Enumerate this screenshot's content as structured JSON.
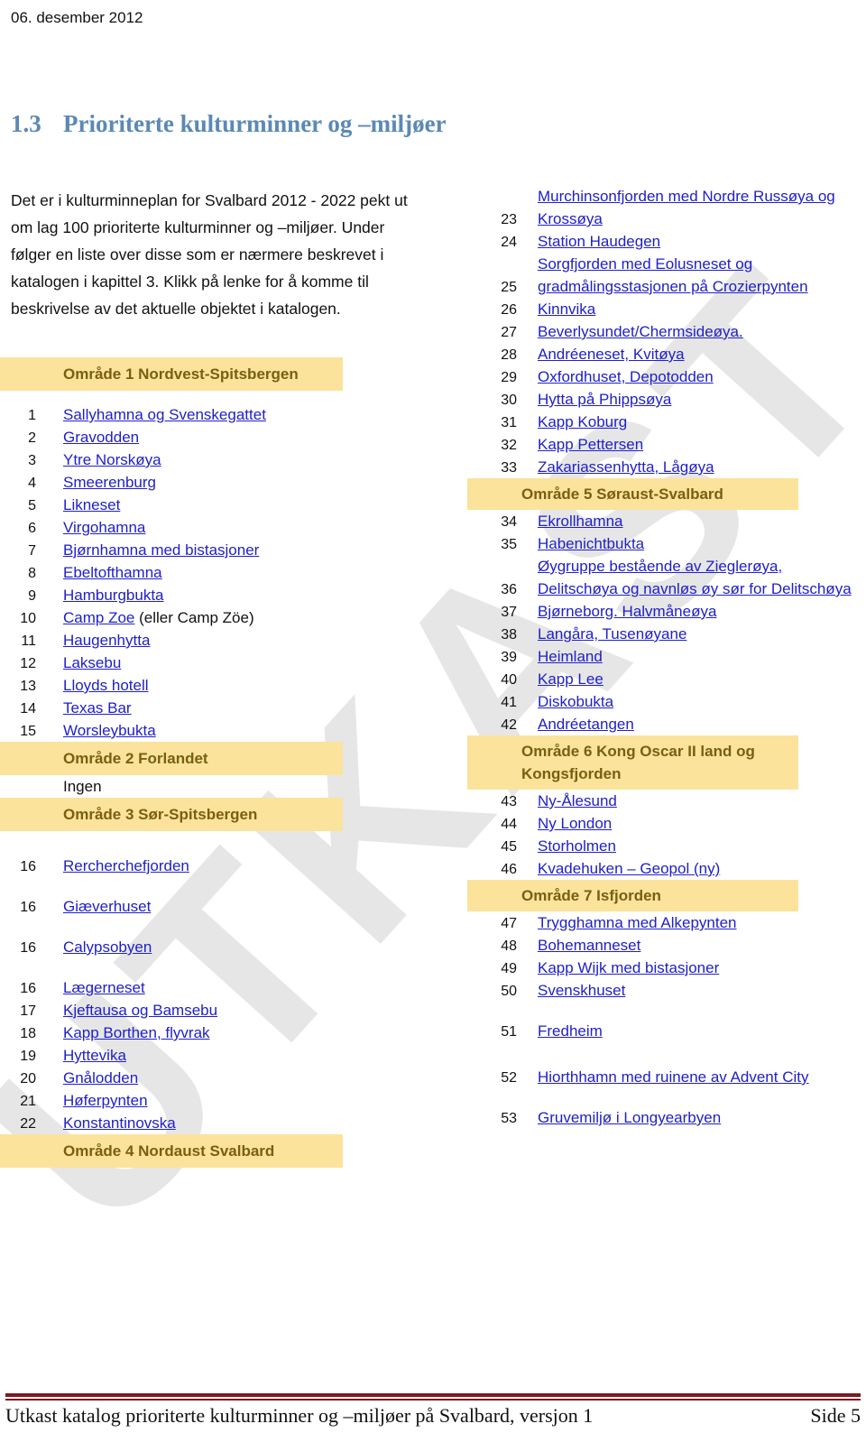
{
  "header": {
    "date": "06. desember 2012"
  },
  "watermark": {
    "text": "UTKAST"
  },
  "title": {
    "number": "1.3",
    "text": "Prioriterte kulturminner og –miljøer"
  },
  "intro": {
    "paragraph": "Det er i kulturminneplan for Svalbard 2012 - 2022 pekt ut om lag 100 prioriterte kulturminner og –miljøer. Under følger en liste over disse som er nærmere beskrevet i katalogen i kapittel 3. Klikk på lenke for å komme til beskrivelse av det aktuelle objektet i katalogen."
  },
  "left_column": [
    {
      "type": "band",
      "label": "Område 1 Nordvest-Spitsbergen"
    },
    {
      "type": "spacer",
      "size": "sp-14"
    },
    {
      "type": "entry",
      "num": "1",
      "label": "Sallyhamna og Svenskegattet",
      "link": true
    },
    {
      "type": "entry",
      "num": "2",
      "label": "Gravodden",
      "link": true
    },
    {
      "type": "entry",
      "num": "3",
      "label": "Ytre Norskøya",
      "link": true
    },
    {
      "type": "entry",
      "num": "4",
      "label": "Smeerenburg",
      "link": true
    },
    {
      "type": "entry",
      "num": "5",
      "label": "Likneset",
      "link": true
    },
    {
      "type": "entry",
      "num": "6",
      "label": "Virgohamna",
      "link": true
    },
    {
      "type": "entry",
      "num": "7",
      "label": "Bjørnhamna med bistasjoner",
      "link": true
    },
    {
      "type": "entry",
      "num": "8",
      "label": "Ebeltofthamna",
      "link": true
    },
    {
      "type": "entry",
      "num": "9",
      "label": "Hamburgbukta",
      "link": true
    },
    {
      "type": "entry",
      "num": "10",
      "label": "Camp Zoe",
      "link": true,
      "suffix": " (eller Camp Zöe)"
    },
    {
      "type": "entry",
      "num": "11",
      "label": "Haugenhytta",
      "link": true
    },
    {
      "type": "entry",
      "num": "12",
      "label": "Laksebu",
      "link": true
    },
    {
      "type": "entry",
      "num": "13",
      "label": "Lloyds hotell",
      "link": true
    },
    {
      "type": "entry",
      "num": "14",
      "label": "Texas Bar",
      "link": true
    },
    {
      "type": "entry",
      "num": "15",
      "label": "Worsleybukta",
      "link": true
    },
    {
      "type": "band",
      "label": "Område 2 Forlandet"
    },
    {
      "type": "entry",
      "num": "",
      "label": "Ingen",
      "link": false
    },
    {
      "type": "band",
      "label": "Område 3 Sør-Spitsbergen"
    },
    {
      "type": "spacer",
      "size": "sp-26"
    },
    {
      "type": "entry",
      "num": "16",
      "label": "Rercherchefjorden",
      "link": true
    },
    {
      "type": "spacer",
      "size": "sp-20"
    },
    {
      "type": "entry",
      "num": "16",
      "label": "Giæverhuset",
      "link": true
    },
    {
      "type": "spacer",
      "size": "sp-20"
    },
    {
      "type": "entry",
      "num": "16",
      "label": "Calypsobyen",
      "link": true
    },
    {
      "type": "spacer",
      "size": "sp-20"
    },
    {
      "type": "entry",
      "num": "16",
      "label": "Lægerneset",
      "link": true
    },
    {
      "type": "entry",
      "num": "17",
      "label": "Kjeftausa og Bamsebu",
      "link": true
    },
    {
      "type": "entry",
      "num": "18",
      "label": "Kapp Borthen, flyvrak",
      "link": true
    },
    {
      "type": "entry",
      "num": "19",
      "label": "Hyttevika",
      "link": true
    },
    {
      "type": "entry",
      "num": "20",
      "label": "Gnålodden",
      "link": true
    },
    {
      "type": "entry",
      "num": "21",
      "label": "Høferpynten",
      "link": true
    },
    {
      "type": "entry",
      "num": "22",
      "label": "Konstantinovska",
      "link": true
    },
    {
      "type": "band",
      "label": "Område 4 Nordaust Svalbard"
    }
  ],
  "right_column": [
    {
      "type": "entry",
      "num": "23",
      "label": "Murchinsonfjorden med Nordre Russøya og Krossøya",
      "link": true
    },
    {
      "type": "entry",
      "num": "24",
      "label": "Station Haudegen",
      "link": true
    },
    {
      "type": "entry",
      "num": "25",
      "label": "Sorgfjorden med Eolusneset og gradmålingsstasjonen på Crozierpynten",
      "link": true
    },
    {
      "type": "entry",
      "num": "26",
      "label": "Kinnvika",
      "link": true
    },
    {
      "type": "entry",
      "num": "27",
      "label": "Beverlysundet/Chermsideøya.",
      "link": true
    },
    {
      "type": "entry",
      "num": "28",
      "label": "Andréeneset, Kvitøya",
      "link": true
    },
    {
      "type": "entry",
      "num": "29",
      "label": "Oxfordhuset, Depotodden",
      "link": true
    },
    {
      "type": "entry",
      "num": "30",
      "label": "Hytta på Phippsøya",
      "link": true
    },
    {
      "type": "entry",
      "num": "31",
      "label": "Kapp Koburg",
      "link": true
    },
    {
      "type": "entry",
      "num": "32",
      "label": "Kapp Pettersen",
      "link": true
    },
    {
      "type": "entry",
      "num": "33",
      "label": "Zakariassenhytta, Lågøya",
      "link": true
    },
    {
      "type": "band",
      "label": "Område 5 Søraust-Svalbard"
    },
    {
      "type": "entry",
      "num": "34",
      "label": "Ekrollhamna",
      "link": true
    },
    {
      "type": "entry",
      "num": "35",
      "label": "Habenichtbukta",
      "link": true
    },
    {
      "type": "entry",
      "num": "36",
      "label": "Øygruppe bestående av Zieglerøya, Delitschøya og navnløs øy sør for Delitschøya",
      "link": true
    },
    {
      "type": "entry",
      "num": "37",
      "label": "Bjørneborg. Halvmåneøya",
      "link": true
    },
    {
      "type": "entry",
      "num": "38",
      "label": "Langåra, Tusenøyane",
      "link": true
    },
    {
      "type": "entry",
      "num": "39",
      "label": "Heimland",
      "link": true
    },
    {
      "type": "entry",
      "num": "40",
      "label": "Kapp Lee",
      "link": true
    },
    {
      "type": "entry",
      "num": "41",
      "label": "Diskobukta",
      "link": true
    },
    {
      "type": "entry",
      "num": "42",
      "label": "Andréetangen",
      "link": true
    },
    {
      "type": "band",
      "label": "Område 6 Kong Oscar II land og Kongsfjorden"
    },
    {
      "type": "entry",
      "num": "43",
      "label": "Ny-Ålesund",
      "link": true
    },
    {
      "type": "entry",
      "num": "44",
      "label": "Ny London",
      "link": true
    },
    {
      "type": "entry",
      "num": "45",
      "label": "Storholmen",
      "link": true
    },
    {
      "type": "entry",
      "num": "46",
      "label": "Kvadehuken – Geopol (ny)",
      "link": true
    },
    {
      "type": "band",
      "label": "Område 7 Isfjorden"
    },
    {
      "type": "entry",
      "num": "47",
      "label": "Trygghamna med Alkepynten",
      "link": true
    },
    {
      "type": "entry",
      "num": "48",
      "label": "Bohemanneset",
      "link": true
    },
    {
      "type": "entry",
      "num": "49",
      "label": "Kapp Wijk med bistasjoner",
      "link": true
    },
    {
      "type": "entry",
      "num": "50",
      "label": "Svenskhuset",
      "link": true
    },
    {
      "type": "spacer",
      "size": "sp-20"
    },
    {
      "type": "entry",
      "num": "51",
      "label": "Fredheim",
      "link": true
    },
    {
      "type": "spacer",
      "size": "sp-26"
    },
    {
      "type": "entry",
      "num": "52",
      "label": "Hiorthhamn med ruinene av Advent City",
      "link": true
    },
    {
      "type": "spacer",
      "size": "sp-20"
    },
    {
      "type": "entry",
      "num": "53",
      "label": "Gruvemiljø i Longyearbyen",
      "link": true
    }
  ],
  "footer": {
    "text": "Utkast katalog prioriterte kulturminner og –miljøer på Svalbard, versjon 1",
    "page": "Side 5"
  },
  "colors": {
    "band_background": "#FBE39C",
    "band_text": "#7B5E10",
    "link": "#2020C8",
    "title": "#5B89B5",
    "footer_rule": "#7B1B22",
    "watermark": "#E6E6E6"
  }
}
